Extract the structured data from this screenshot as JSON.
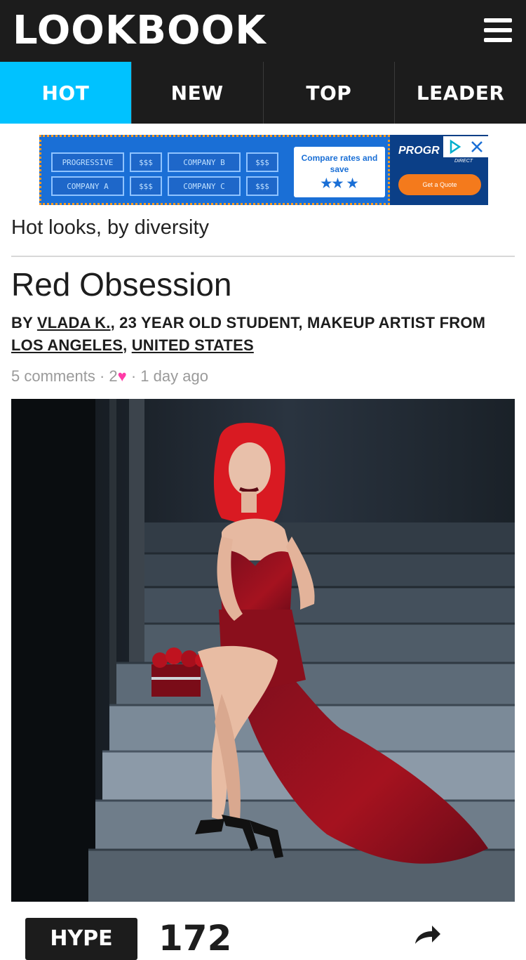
{
  "header": {
    "logo": "LOOKBOOK",
    "menu_icon": "hamburger-menu-icon"
  },
  "tabs": [
    {
      "label": "HOT",
      "active": true
    },
    {
      "label": "NEW",
      "active": false
    },
    {
      "label": "TOP",
      "active": false
    },
    {
      "label": "LEADER",
      "active": false
    }
  ],
  "ad": {
    "cells": [
      "PROGRESSIVE",
      "$$$",
      "COMPANY B",
      "$$$",
      "COMPANY A",
      "$$$",
      "COMPANY C",
      "$$$"
    ],
    "compare_text": "Compare rates and save",
    "brand": "PROGR",
    "brand_sub": "DIRECT",
    "cta": "Get a Quote",
    "colors": {
      "blue": "#1a6fd6",
      "navy": "#0b3f87",
      "orange": "#f47a1c"
    }
  },
  "feed": {
    "section_title": "Hot looks, by diversity"
  },
  "look": {
    "title": "Red Obsession",
    "by_prefix": "BY",
    "author": "VLADA K.",
    "author_desc": ", 23 YEAR OLD STUDENT, MAKEUP ARTIST FROM",
    "city": "LOS ANGELES",
    "comma": ",",
    "country": "UNITED STATES",
    "comments": "5 comments",
    "sep1": "·",
    "hearts_count": "2",
    "heart_symbol": "♥",
    "sep2": "·",
    "time_ago": "1 day ago",
    "photo_alt": "woman with red hair in burgundy gown sitting on concrete stairs"
  },
  "actions": {
    "hype_label": "HYPE",
    "hype_count": "172"
  },
  "colors": {
    "accent": "#00c2ff",
    "header_bg": "#1c1c1c",
    "heart": "#ff3ba7"
  }
}
